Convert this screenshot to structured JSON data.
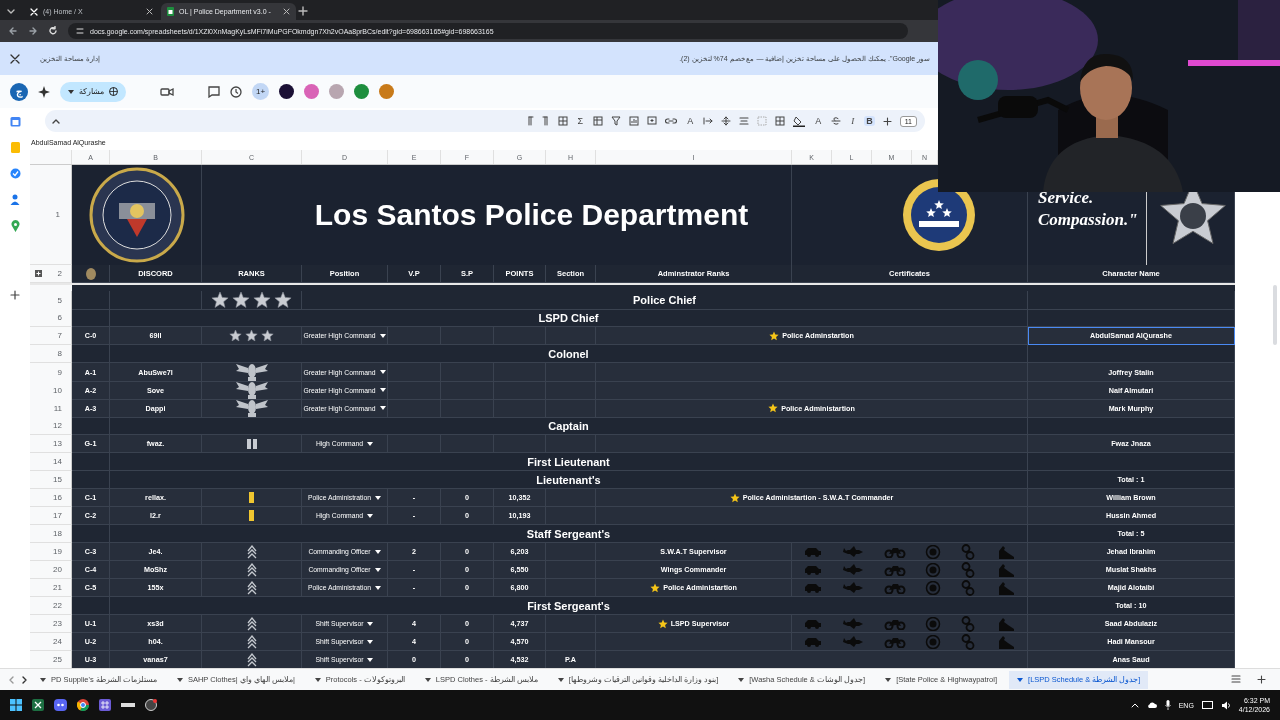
{
  "browser": {
    "tabs": [
      {
        "title": "(4) Home / X",
        "selected": false
      },
      {
        "title": "OL | Police Department v3.0 - ",
        "selected": true
      }
    ],
    "url": "docs.google.com/spreadsheets/d/1XZl0XnMagKyLsMFi7iMuPGFOkmdgn7Xh2vOAa8prBCs/edit?gid=698663165#gid=698663165"
  },
  "banner": {
    "action": "إدارة مساحة التخزين",
    "message": "سور Google\". يمكنك الحصول على مساحة تخزين إضافية — مع خصم 74% لتخزين (2)."
  },
  "toolbar": {
    "account": "ج",
    "share": "مشاركة",
    "more_collaborators": "1+",
    "collaborators": [
      {
        "color": "#1b1035"
      },
      {
        "color": "#d963b6"
      },
      {
        "color": "#b8a6b0"
      },
      {
        "color": "#1e8e3e"
      },
      {
        "color": "#c87a1a"
      }
    ]
  },
  "format_bar": {
    "sum": "Σ",
    "text_color": "A",
    "text_style": "A",
    "italic": "I",
    "bold": "B",
    "bold_on": true,
    "font_size": "11"
  },
  "formula": "AbdulSamad AlQurashe",
  "columns": [
    "A",
    "B",
    "C",
    "D",
    "E",
    "F",
    "G",
    "H",
    "I",
    "K",
    "L",
    "M",
    "N"
  ],
  "sheet": {
    "title": "Los Santos Police Department",
    "motto": [
      "Service.",
      "Compassion.\""
    ],
    "header_row": "2",
    "title_row": "1",
    "headers": [
      "DISCORD",
      "RANKS",
      "Position",
      "V.P",
      "S.P",
      "POINTS",
      "Section",
      "Adminstrator Ranks",
      "Certificates",
      "Character Name"
    ],
    "rows": [
      {
        "kind": "section",
        "row": "5",
        "title": "Police Chief",
        "rank": {
          "kind": "stars",
          "stars": 4
        }
      },
      {
        "kind": "section",
        "row": "6",
        "title": "LSPD Chief"
      },
      {
        "kind": "member",
        "row": "7",
        "code": "C-0",
        "discord": "69ll",
        "rank": {
          "kind": "stars",
          "stars": 3
        },
        "position": "Greater High Command",
        "admin": {
          "text": "Police Adminstartion",
          "starred": true
        },
        "certified": false,
        "name": "AbdulSamad AlQurashe",
        "selected": true
      },
      {
        "kind": "section",
        "row": "8",
        "title": "Colonel"
      },
      {
        "kind": "member",
        "row": "9",
        "code": "A-1",
        "discord": "AbuSwe7l",
        "rank": {
          "kind": "eagle"
        },
        "position": "Greater High Command",
        "certified": false,
        "name": "Joffrey Stalin",
        "selected": false
      },
      {
        "kind": "member",
        "row": "10",
        "code": "A-2",
        "discord": "Sove",
        "rank": {
          "kind": "eagle"
        },
        "position": "Greater High Command",
        "certified": false,
        "name": "Naif Almutari",
        "selected": false
      },
      {
        "kind": "member",
        "row": "11",
        "code": "A-3",
        "discord": "Dappi",
        "rank": {
          "kind": "eagle"
        },
        "position": "Greater High Command",
        "admin": {
          "text": "Police Administartion",
          "starred": true
        },
        "certified": false,
        "name": "Mark Murphy",
        "selected": false
      },
      {
        "kind": "section",
        "row": "12",
        "title": "Captain"
      },
      {
        "kind": "member",
        "row": "13",
        "code": "G-1",
        "discord": "fwaz.",
        "rank": {
          "kind": "bars"
        },
        "position": "High Command",
        "certified": false,
        "name": "Fwaz Jnaza",
        "selected": false
      },
      {
        "kind": "section",
        "row": "14",
        "title": "First Lieutenant"
      },
      {
        "kind": "section",
        "row": "15",
        "title": "Lieutenant's",
        "total": "Total : 1"
      },
      {
        "kind": "member",
        "row": "16",
        "code": "C-1",
        "discord": "rellax.",
        "rank": {
          "kind": "bar"
        },
        "position": "Police Administration",
        "vp": "-",
        "sp": "0",
        "points": "10,352",
        "admin": {
          "text": "Police Administartion -  S.W.A.T Commander",
          "starred": true
        },
        "certified": false,
        "name": "William Brown",
        "selected": false
      },
      {
        "kind": "member",
        "row": "17",
        "code": "C-2",
        "discord": "l2.r",
        "rank": {
          "kind": "bar"
        },
        "position": "High Command",
        "vp": "-",
        "sp": "0",
        "points": "10,193",
        "certified": false,
        "name": "Hussin Ahmed",
        "selected": false
      },
      {
        "kind": "section",
        "row": "18",
        "title": "Staff Sergeant's",
        "total": "Total : 5"
      },
      {
        "kind": "member",
        "row": "19",
        "code": "C-3",
        "discord": "Je4.",
        "rank": {
          "kind": "chevrons"
        },
        "position": "Commanding Officer",
        "vp": "2",
        "sp": "0",
        "points": "6,203",
        "admin": {
          "text": "S.W.A.T Supervisor",
          "starred": false
        },
        "certified": true,
        "name": "Jehad Ibrahim",
        "selected": false
      },
      {
        "kind": "member",
        "row": "20",
        "code": "C-4",
        "discord": "MoShz",
        "rank": {
          "kind": "chevrons"
        },
        "position": "Commanding Officer",
        "vp": "-",
        "sp": "0",
        "points": "6,550",
        "admin": {
          "text": "Wings Commander",
          "starred": false
        },
        "certified": true,
        "name": "Muslat Shakhs",
        "selected": false
      },
      {
        "kind": "member",
        "row": "21",
        "code": "C-5",
        "discord": "155x",
        "rank": {
          "kind": "chevrons"
        },
        "position": "Police Administration",
        "vp": "-",
        "sp": "0",
        "points": "6,800",
        "admin": {
          "text": "Police Administartion",
          "starred": true
        },
        "certified": true,
        "name": "Majid Alotaibi",
        "selected": false
      },
      {
        "kind": "section",
        "row": "22",
        "title": "First Sergeant's",
        "total": "Total : 10"
      },
      {
        "kind": "member",
        "row": "23",
        "code": "U-1",
        "discord": "xs3d",
        "rank": {
          "kind": "chevrons"
        },
        "position": "Shift Supervisor",
        "vp": "4",
        "sp": "0",
        "points": "4,737",
        "admin": {
          "text": "LSPD Supervisor",
          "starred": true
        },
        "certified": true,
        "name": "Saad Abdulaziz",
        "selected": false
      },
      {
        "kind": "member",
        "row": "24",
        "code": "U-2",
        "discord": "h04.",
        "rank": {
          "kind": "chevrons"
        },
        "position": "Shift Supervisor",
        "vp": "4",
        "sp": "0",
        "points": "4,570",
        "certified": true,
        "name": "Hadi Mansour",
        "selected": false
      },
      {
        "kind": "member",
        "row": "25",
        "code": "U-3",
        "discord": "vanas7",
        "rank": {
          "kind": "chevrons"
        },
        "position": "Shift Supervisor",
        "vp": "0",
        "sp": "0",
        "points": "4,532",
        "section": "P.A",
        "certified": false,
        "name": "Anas Saud",
        "selected": false
      }
    ]
  },
  "sheet_tabs": [
    {
      "label": "PD Supplie's مستلزمات الشرطة",
      "selected": false
    },
    {
      "label": "SAHP Clothes| ملابس الهاي واي|",
      "selected": false
    },
    {
      "label": "Protocols - البروتوكولات",
      "selected": false
    },
    {
      "label": "LSPD Clothes - ملابس الشرطة",
      "selected": false
    },
    {
      "label": "[بنود وزارة الداخلية وقوانين الترقيات وشروطها]",
      "selected": false
    },
    {
      "label": "[Washa Schedule & جدول الوشات]",
      "selected": false
    },
    {
      "label": "[State Police & Highwaypatrol]",
      "selected": false
    },
    {
      "label": "[LSPD Schedule & جدول الشرطة]",
      "selected": true
    }
  ],
  "taskbar": {
    "language": "ENG",
    "time": "6:32 PM",
    "date": "4/12/2026"
  }
}
